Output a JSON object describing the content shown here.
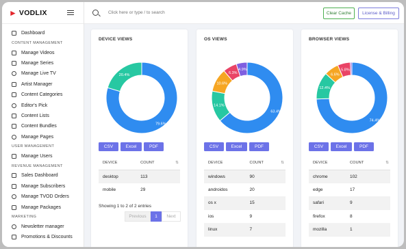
{
  "app": {
    "brand": "VODLIX"
  },
  "search": {
    "placeholder": "Click here or type / to search"
  },
  "top_buttons": {
    "clear_cache": "Clear Cache",
    "license": "License & Billing"
  },
  "sidebar": {
    "items": [
      {
        "type": "item",
        "label": "Dashboard"
      },
      {
        "type": "section",
        "label": "CONTENT MANAGEMENT"
      },
      {
        "type": "item",
        "label": "Manage Videos"
      },
      {
        "type": "item",
        "label": "Manage Series"
      },
      {
        "type": "item",
        "label": "Manage Live TV"
      },
      {
        "type": "item",
        "label": "Artist Manager"
      },
      {
        "type": "item",
        "label": "Content Categories"
      },
      {
        "type": "item",
        "label": "Editor's Pick"
      },
      {
        "type": "item",
        "label": "Content Lists"
      },
      {
        "type": "item",
        "label": "Content Bundles"
      },
      {
        "type": "item",
        "label": "Manage Pages"
      },
      {
        "type": "section",
        "label": "USER MANAGEMENT"
      },
      {
        "type": "item",
        "label": "Manage Users"
      },
      {
        "type": "section",
        "label": "REVENUE MANAGEMENT"
      },
      {
        "type": "item",
        "label": "Sales Dashboard"
      },
      {
        "type": "item",
        "label": "Manage Subscribers"
      },
      {
        "type": "item",
        "label": "Manage TVOD Orders"
      },
      {
        "type": "item",
        "label": "Manage Packages"
      },
      {
        "type": "section",
        "label": "MARKETING"
      },
      {
        "type": "item",
        "label": "Newsletter manager"
      },
      {
        "type": "item",
        "label": "Promotions & Discounts"
      }
    ]
  },
  "cards": [
    {
      "title": "DEVICE VIEWS",
      "export": [
        "CSV",
        "Excel",
        "PDF"
      ],
      "columns": [
        "DEVICE",
        "COUNT"
      ],
      "rows": [
        [
          "desktop",
          "113"
        ],
        [
          "mobile",
          "29"
        ]
      ],
      "entries": "Showing 1 to 2 of 2 entries",
      "pager": {
        "prev": "Previous",
        "page": "1",
        "next": "Next"
      }
    },
    {
      "title": "OS VIEWS",
      "export": [
        "CSV",
        "Excel",
        "PDF"
      ],
      "columns": [
        "DEVICE",
        "COUNT"
      ],
      "rows": [
        [
          "windows",
          "90"
        ],
        [
          "androidos",
          "20"
        ],
        [
          "os x",
          "15"
        ],
        [
          "ios",
          "9"
        ],
        [
          "linux",
          "7"
        ]
      ]
    },
    {
      "title": "BROWSER VIEWS",
      "export": [
        "CSV",
        "Excel",
        "PDF"
      ],
      "columns": [
        "DEVICE",
        "COUNT"
      ],
      "rows": [
        [
          "chrome",
          "102"
        ],
        [
          "edge",
          "17"
        ],
        [
          "safari",
          "9"
        ],
        [
          "firefox",
          "8"
        ],
        [
          "mozilla",
          "1"
        ]
      ]
    }
  ],
  "chart_data": [
    {
      "type": "pie",
      "title": "DEVICE VIEWS",
      "categories": [
        "desktop",
        "mobile"
      ],
      "values": [
        79.6,
        20.4
      ],
      "labels": [
        "79.6%",
        "20.4%"
      ],
      "colors": [
        "#2f8cf0",
        "#27c8a2"
      ]
    },
    {
      "type": "pie",
      "title": "OS VIEWS",
      "categories": [
        "windows",
        "androidos",
        "os x",
        "ios",
        "linux"
      ],
      "values": [
        63.4,
        14.1,
        10.6,
        6.3,
        4.9
      ],
      "labels": [
        "63.4%",
        "14.1%",
        "10.6%",
        "6.3%",
        "4.9%"
      ],
      "colors": [
        "#2f8cf0",
        "#27c8a2",
        "#f6a623",
        "#e94466",
        "#7f5fe0"
      ]
    },
    {
      "type": "pie",
      "title": "BROWSER VIEWS",
      "categories": [
        "chrome",
        "edge",
        "safari",
        "firefox",
        "mozilla"
      ],
      "values": [
        74.4,
        12.4,
        6.6,
        5.8,
        0.7
      ],
      "labels": [
        "74.4%",
        "12.4%",
        "6.6%",
        "5.8%",
        ""
      ],
      "colors": [
        "#2f8cf0",
        "#27c8a2",
        "#f6a623",
        "#e94466",
        "#7f5fe0"
      ]
    }
  ]
}
